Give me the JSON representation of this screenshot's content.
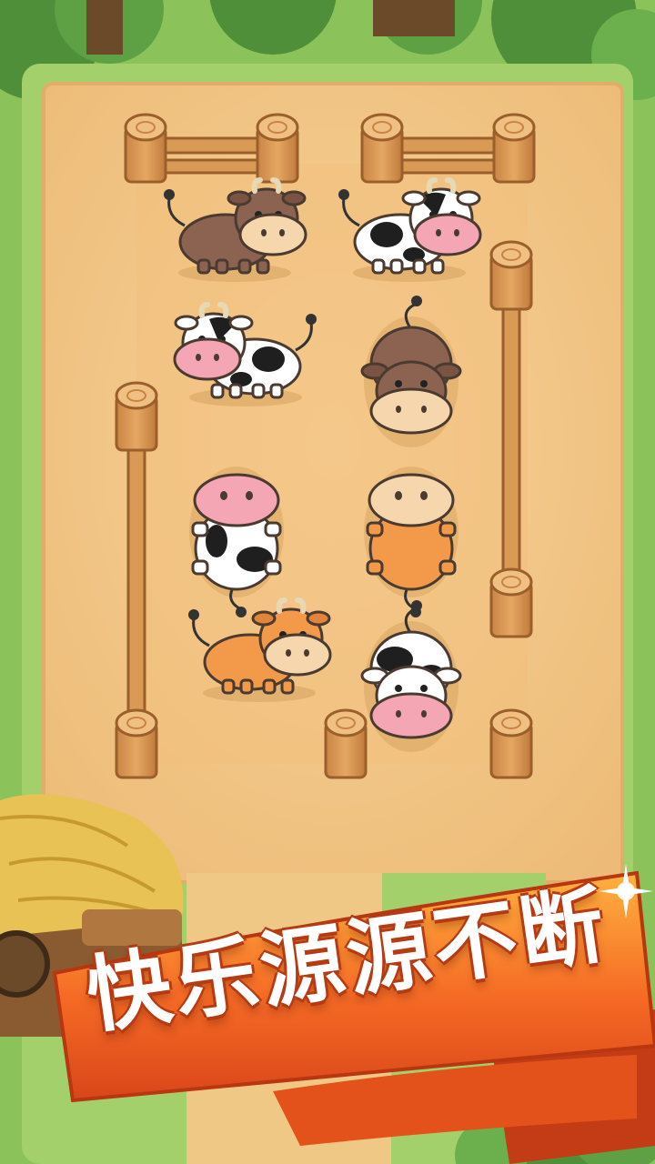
{
  "game": {
    "banner_text": "快乐源源不断"
  },
  "colors": {
    "grass": "#8cc25a",
    "dirt_field": "#f3c98a",
    "fence_wood": "#d99a55",
    "banner_orange": "#f26a2a",
    "cow_brown": "#8b6350",
    "cow_orange": "#f29a4a",
    "cow_holstein_nose": "#f4a6b4"
  },
  "board": {
    "cows": [
      {
        "kind": "brown",
        "facing": "right"
      },
      {
        "kind": "holstein",
        "facing": "right"
      },
      {
        "kind": "holstein",
        "facing": "left"
      },
      {
        "kind": "brown",
        "facing": "down"
      },
      {
        "kind": "holstein",
        "facing": "up"
      },
      {
        "kind": "orange",
        "facing": "up"
      },
      {
        "kind": "orange",
        "facing": "right"
      },
      {
        "kind": "holstein",
        "facing": "down"
      }
    ]
  }
}
